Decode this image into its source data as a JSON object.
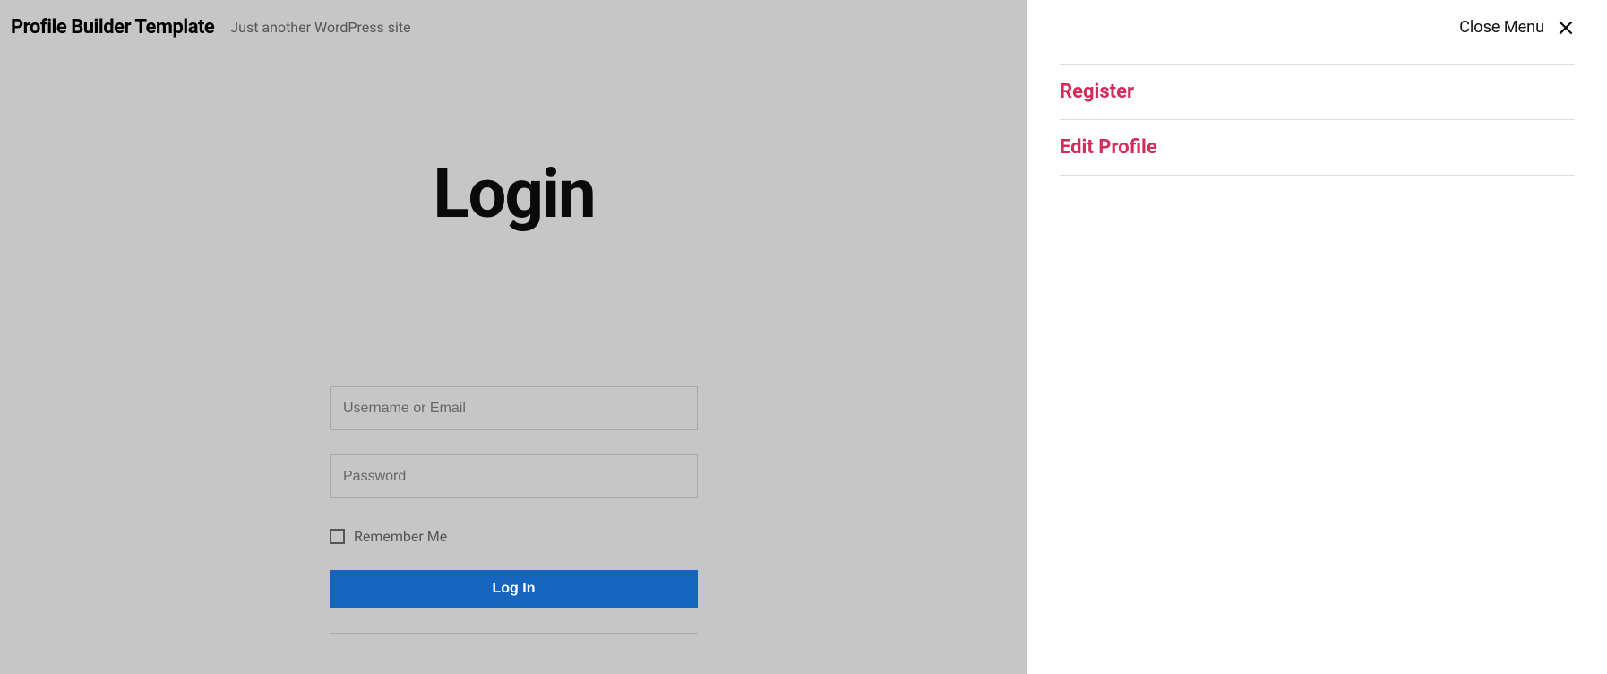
{
  "header": {
    "site_title": "Profile Builder Template",
    "tagline": "Just another WordPress site"
  },
  "page": {
    "title": "Login"
  },
  "form": {
    "username_placeholder": "Username or Email",
    "password_placeholder": "Password",
    "remember_label": "Remember Me",
    "submit_label": "Log In"
  },
  "menu": {
    "close_label": "Close Menu",
    "items": [
      {
        "label": "Register"
      },
      {
        "label": "Edit Profile"
      }
    ]
  }
}
